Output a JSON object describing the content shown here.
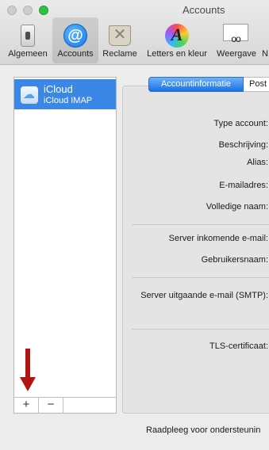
{
  "window": {
    "title": "Accounts"
  },
  "toolbar": {
    "items": [
      {
        "label": "Algemeen",
        "icon": "switch-icon"
      },
      {
        "label": "Accounts",
        "icon": "at-sign-icon"
      },
      {
        "label": "Reclame",
        "icon": "junk-mail-icon"
      },
      {
        "label": "Letters en kleur",
        "icon": "fonts-colors-icon"
      },
      {
        "label": "Weergave",
        "icon": "view-glasses-icon"
      }
    ],
    "accounts_glyph": "@",
    "fonts_glyph": "A",
    "junk_glyph": "✕",
    "view_glyph": "oo",
    "overflow_glyph": "N"
  },
  "accounts": [
    {
      "name": "iCloud",
      "type": "iCloud IMAP",
      "icon": "icloud-icon"
    }
  ],
  "cloud_glyph": "☁",
  "sidebar_controls": {
    "add": "+",
    "remove": "−"
  },
  "tabs": {
    "selected": "Accountinformatie",
    "other": "Post"
  },
  "form": {
    "type_account": "Type account:",
    "description": "Beschrijving:",
    "alias": "Alias:",
    "email": "E-mailadres:",
    "full_name": "Volledige naam:",
    "incoming_server": "Server inkomende e-mail:",
    "username": "Gebruikersnaam:",
    "outgoing_server": "Server uitgaande e-mail (SMTP):",
    "tls_certificate": "TLS-certificaat:"
  },
  "footer": {
    "support_text": "Raadpleeg voor ondersteunin"
  },
  "colors": {
    "accent": "#3a87e6",
    "annotation_arrow": "#b21414"
  }
}
